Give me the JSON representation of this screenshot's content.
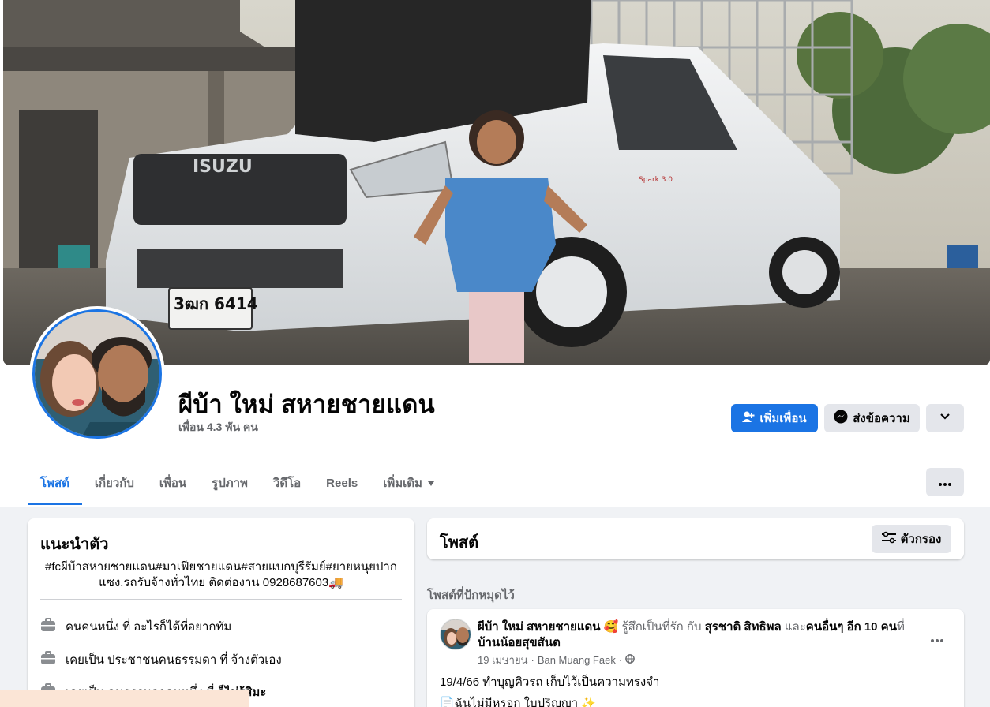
{
  "profile": {
    "name": "ผีบ้า ใหม่ สหายชายแดน",
    "friends": "เพื่อน 4.3 พัน คน",
    "plate": "3ฒก 6414",
    "truck_brand": "ISUZU",
    "sticker": "Spark 3.0"
  },
  "actions": {
    "add_friend": "เพิ่มเพื่อน",
    "message": "ส่งข้อความ"
  },
  "tabs": [
    {
      "label": "โพสต์",
      "active": true
    },
    {
      "label": "เกี่ยวกับ"
    },
    {
      "label": "เพื่อน"
    },
    {
      "label": "รูปภาพ"
    },
    {
      "label": "วิดีโอ"
    },
    {
      "label": "Reels"
    },
    {
      "label": "เพิ่มเติม"
    }
  ],
  "intro": {
    "title": "แนะนำตัว",
    "bio_line1": "#fcผีบ้าสหายชายแดน#มาเฟียชายแดน#สายแบกบุรีรัมย์#ยายหนุยปาก",
    "bio_line2": "แซง.รถรับจ้างทั่วไทย ติดต่องาน 0928687603🚚",
    "rows": [
      {
        "prefix": "คนคนหนึ่ง ที่ ",
        "value": "อะไรก็ได้ที่อยากทัม",
        "bold": false
      },
      {
        "prefix": "เคยเป็น ประชาชนคนธรรมดา ที่ ",
        "value": "จ้างตัวเอง",
        "bold": false
      },
      {
        "prefix": "เคยเป็น คนธรรมดาคนหนึ่ง ที่ ",
        "value": "ก็ไม่รู้สิมะ",
        "bold": true
      }
    ]
  },
  "posts": {
    "title": "โพสต์",
    "filter": "ตัวกรอง",
    "pinned_label": "โพสต์ที่ปักหมุดไว้"
  },
  "post": {
    "author": "ผีบ้า ใหม่ สหายชายแดน",
    "emoji": "🥰",
    "feeling": "รู้สึกเป็นที่รัก กับ",
    "tagged": "สุรชาติ สิทธิพล",
    "and": "และ",
    "others": "คนอื่นๆ อีก 10 คน",
    "at": "ที่",
    "place": "บ้านน้อยสุขสันต",
    "date": "19 เมษายน",
    "location": "Ban Muang Faek",
    "text1": "19/4/66 ทำบุญคิวรถ เก็บไว้เป็นความทรงจำ",
    "text2": "📄ฉันไม่มีหรอก ใบปริญญา ✨"
  },
  "colors": {
    "accent": "#1b74e4",
    "background": "#f0f2f5",
    "secondary_text": "#65676b"
  }
}
